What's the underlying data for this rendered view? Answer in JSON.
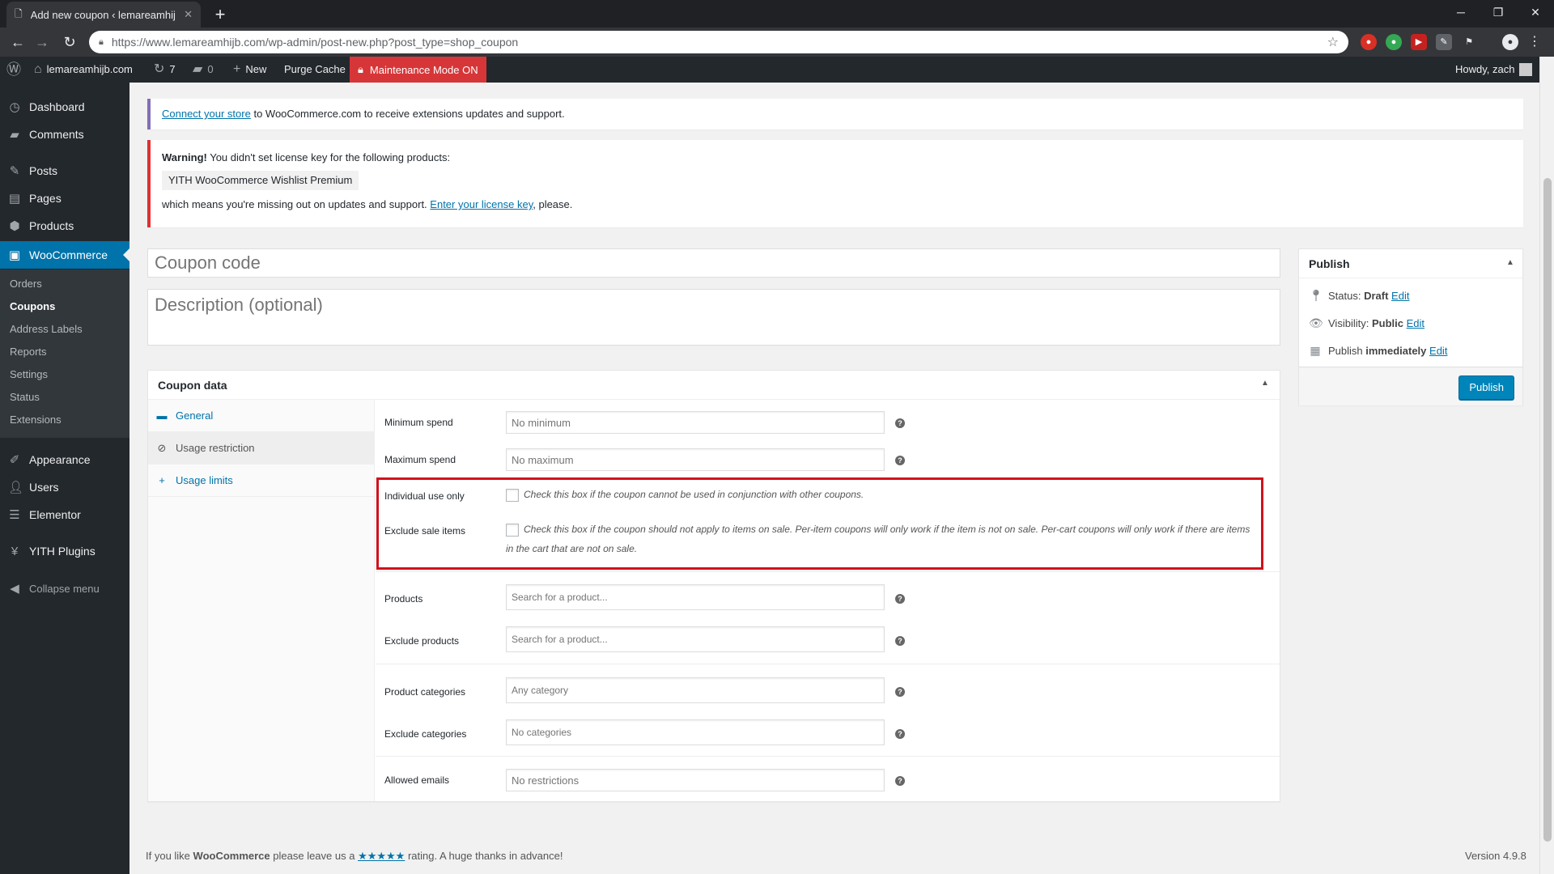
{
  "browser": {
    "tab_title": "Add new coupon ‹ lemareamhijb",
    "url": "https://www.lemareamhijb.com/wp-admin/post-new.php?post_type=shop_coupon"
  },
  "adminbar": {
    "site_name": "lemareamhijb.com",
    "updates_count": "7",
    "comments_count": "0",
    "new_label": "New",
    "purge_cache": "Purge Cache",
    "maintenance": "Maintenance Mode ON",
    "greeting": "Howdy, zach"
  },
  "sidebar": {
    "items": [
      {
        "label": "Dashboard",
        "icon": "dashboard-icon"
      },
      {
        "label": "Comments",
        "icon": "comments-icon"
      },
      {
        "label": "Posts",
        "icon": "pin-icon"
      },
      {
        "label": "Pages",
        "icon": "pages-icon"
      },
      {
        "label": "Products",
        "icon": "products-icon"
      },
      {
        "label": "WooCommerce",
        "icon": "woocommerce-icon"
      },
      {
        "label": "Appearance",
        "icon": "brush-icon"
      },
      {
        "label": "Users",
        "icon": "users-icon"
      },
      {
        "label": "Elementor",
        "icon": "elementor-icon"
      },
      {
        "label": "YITH Plugins",
        "icon": "yith-icon"
      },
      {
        "label": "Collapse menu",
        "icon": "collapse-icon"
      }
    ],
    "submenu": [
      "Orders",
      "Coupons",
      "Address Labels",
      "Reports",
      "Settings",
      "Status",
      "Extensions"
    ]
  },
  "notices": {
    "connect_link": "Connect your store",
    "connect_text": " to WooCommerce.com to receive extensions updates and support.",
    "warning_bold": "Warning!",
    "warning_text": " You didn't set license key for the following products:",
    "product_tag": "YITH WooCommerce Wishlist Premium",
    "missing_text": "which means you're missing out on updates and support. ",
    "license_link": "Enter your license key",
    "please": ", please."
  },
  "editor": {
    "coupon_code_placeholder": "Coupon code",
    "description_placeholder": "Description (optional)"
  },
  "coupon_data": {
    "title": "Coupon data",
    "tabs": [
      "General",
      "Usage restriction",
      "Usage limits"
    ],
    "fields": {
      "min_spend_label": "Minimum spend",
      "min_spend_placeholder": "No minimum",
      "max_spend_label": "Maximum spend",
      "max_spend_placeholder": "No maximum",
      "individual_label": "Individual use only",
      "individual_desc": "Check this box if the coupon cannot be used in conjunction with other coupons.",
      "exclude_sale_label": "Exclude sale items",
      "exclude_sale_desc": "Check this box if the coupon should not apply to items on sale. Per-item coupons will only work if the item is not on sale. Per-cart coupons will only work if there are items in the cart that are not on sale.",
      "products_label": "Products",
      "products_placeholder": "Search for a product...",
      "exclude_products_label": "Exclude products",
      "exclude_products_placeholder": "Search for a product...",
      "categories_label": "Product categories",
      "categories_placeholder": "Any category",
      "exclude_categories_label": "Exclude categories",
      "exclude_categories_placeholder": "No categories",
      "emails_label": "Allowed emails",
      "emails_placeholder": "No restrictions"
    }
  },
  "publish": {
    "title": "Publish",
    "status_label": "Status: ",
    "status_value": "Draft",
    "visibility_label": "Visibility: ",
    "visibility_value": "Public",
    "publish_label": "Publish ",
    "publish_value": "immediately",
    "edit": "Edit",
    "button": "Publish"
  },
  "footer": {
    "text_1": "If you like ",
    "brand": "WooCommerce",
    "text_2": " please leave us a ",
    "stars": "★★★★★",
    "text_3": " rating. A huge thanks in advance!",
    "version": "Version 4.9.8"
  },
  "colors": {
    "admin_bar": "#23282d",
    "accent": "#0073aa",
    "maintenance": "#d63638",
    "highlight": "#d0121d"
  }
}
